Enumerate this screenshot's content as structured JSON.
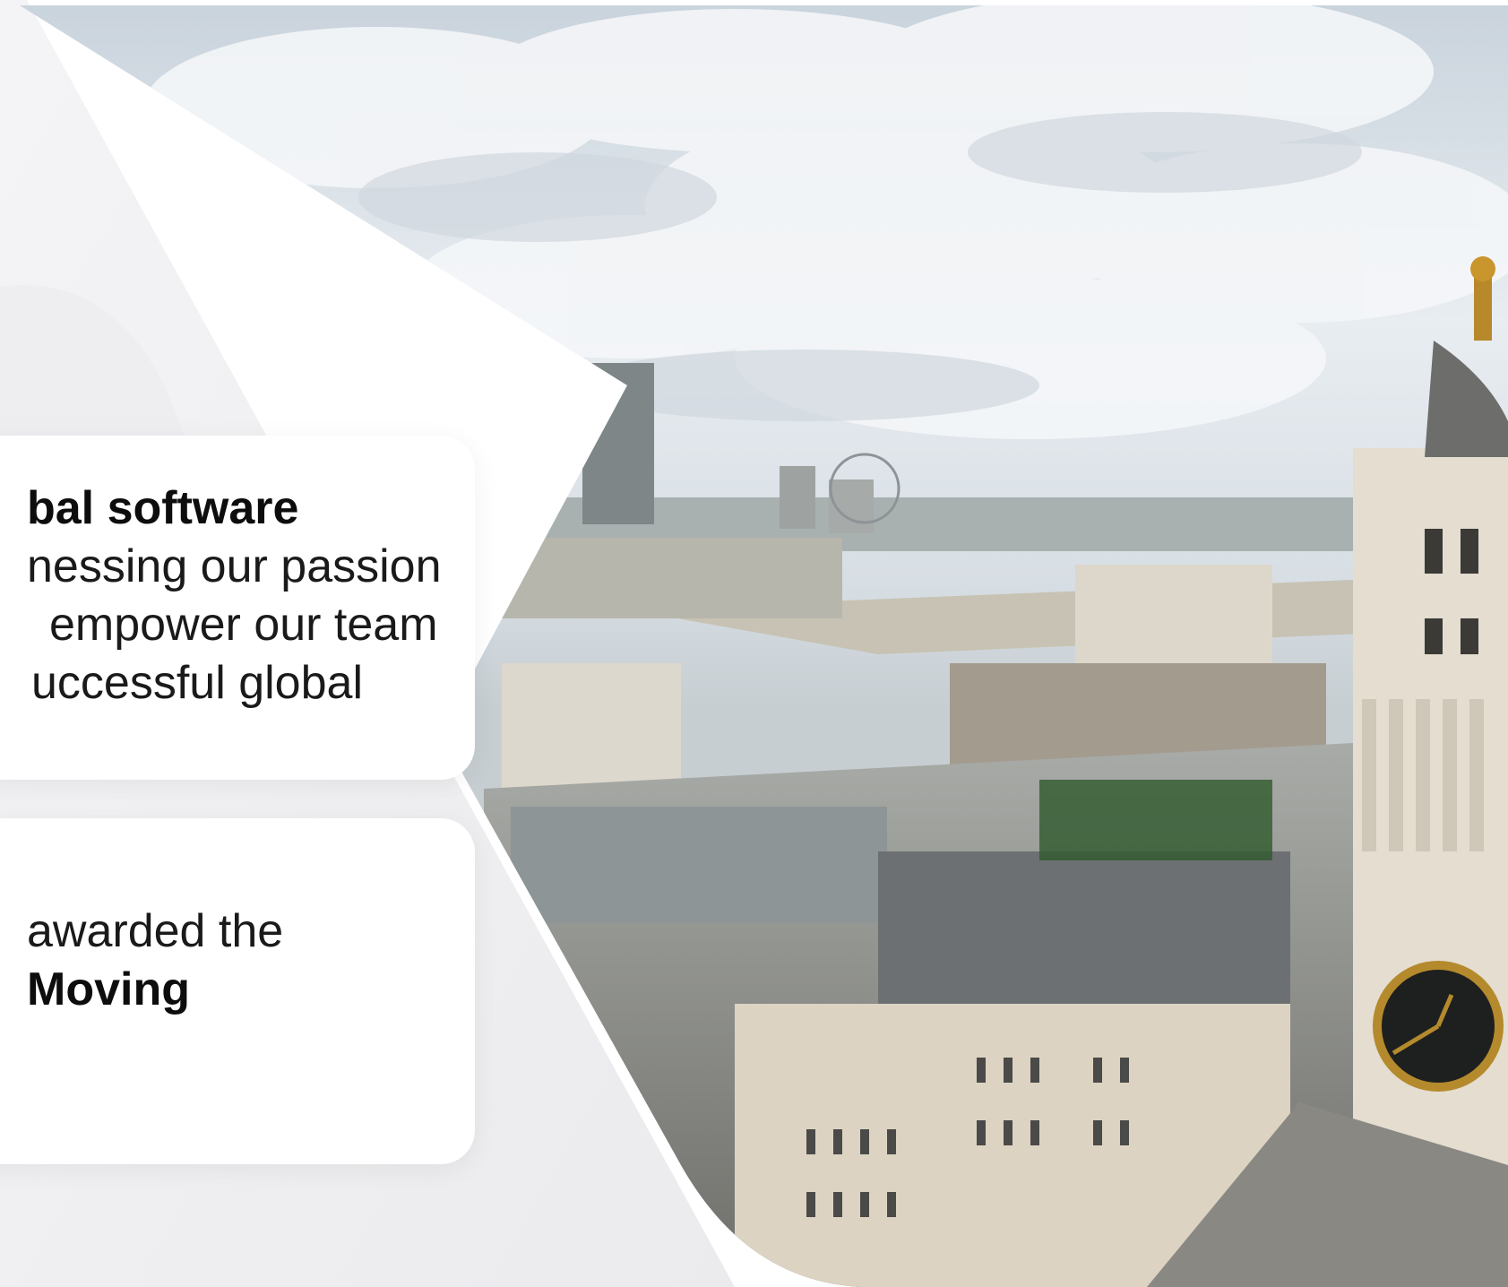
{
  "card_1": {
    "title": "bal software",
    "lines": [
      "nessing our passion",
      "empower our team",
      "uccessful global"
    ]
  },
  "card_2": {
    "line_1": "awarded the",
    "line_2_bold": "Moving"
  },
  "colors": {
    "background": "#ffffff",
    "text": "#1a1a1a",
    "sky": "#dfe6ec"
  },
  "photo": {
    "subject": "city-skyline-photo"
  }
}
